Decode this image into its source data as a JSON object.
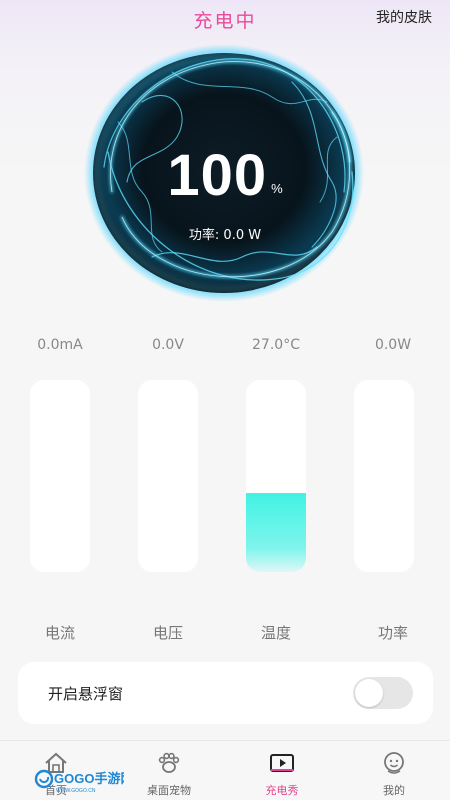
{
  "header": {
    "title": "充电中",
    "skin_label": "我的皮肤"
  },
  "orb": {
    "percent": "100",
    "percent_unit": "%",
    "power_line": "功率: 0.0 W"
  },
  "stats": [
    {
      "value": "0.0mA",
      "label": "电流",
      "level": 0.0
    },
    {
      "value": "0.0V",
      "label": "电压",
      "level": 0.0
    },
    {
      "value": "27.0°C",
      "label": "温度",
      "level": 0.41
    },
    {
      "value": "0.0W",
      "label": "功率",
      "level": 0.0
    }
  ],
  "float_window": {
    "label": "开启悬浮窗",
    "enabled": false
  },
  "tabs": [
    {
      "label": "首页",
      "icon": "home-icon",
      "active": false
    },
    {
      "label": "桌面宠物",
      "icon": "paw-icon",
      "active": false
    },
    {
      "label": "充电秀",
      "icon": "play-screen-icon",
      "active": true
    },
    {
      "label": "我的",
      "icon": "face-icon",
      "active": false
    }
  ],
  "watermark": {
    "text": "GOGO手游网",
    "url_text": "WWW.GOGO.CN"
  },
  "colors": {
    "accent": "#e2448f",
    "fill": "#41f2e4",
    "title": "#ea4a9a"
  }
}
